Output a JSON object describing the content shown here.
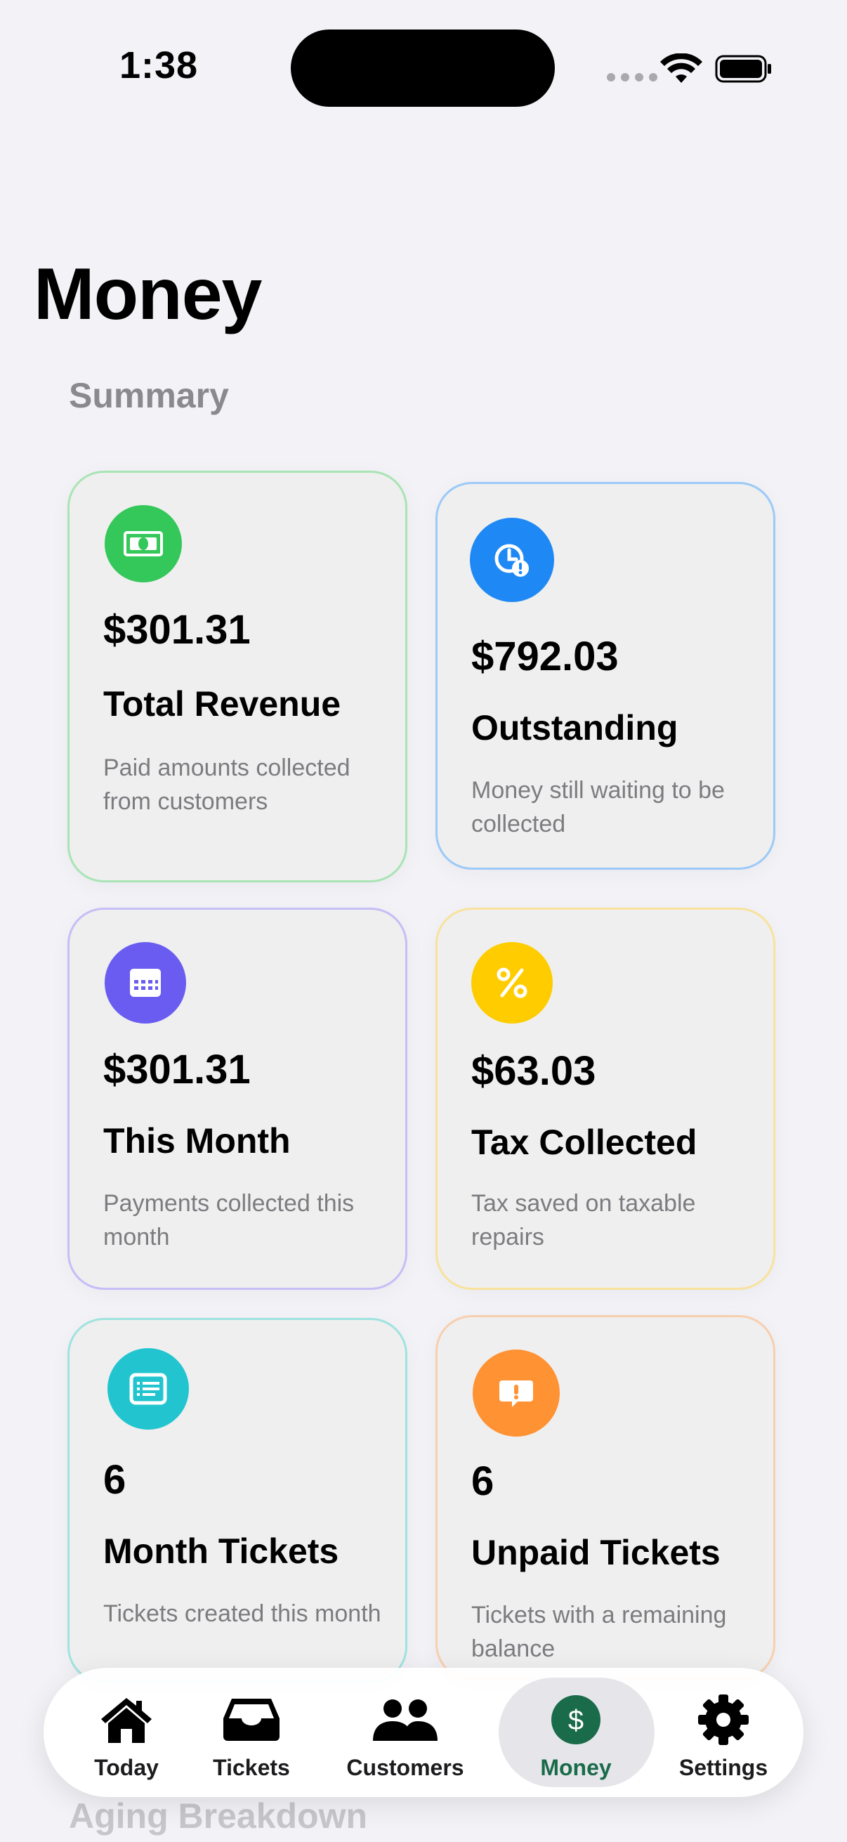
{
  "status_bar": {
    "time": "1:38"
  },
  "page": {
    "title": "Money"
  },
  "summary": {
    "label": "Summary",
    "cards": [
      {
        "value": "$301.31",
        "label": "Total Revenue",
        "desc": "Paid amounts collected from customers",
        "icon": "banknote-icon",
        "color": "#34c759"
      },
      {
        "value": "$792.03",
        "label": "Outstanding",
        "desc": "Money still waiting to be collected",
        "icon": "clock-alert-icon",
        "color": "#1e88f5"
      },
      {
        "value": "$301.31",
        "label": "This Month",
        "desc": "Payments collected this month",
        "icon": "calendar-icon",
        "color": "#6a5cf0"
      },
      {
        "value": "$63.03",
        "label": "Tax Collected",
        "desc": "Tax saved on taxable repairs",
        "icon": "percent-icon",
        "color": "#ffcc00"
      },
      {
        "value": "6",
        "label": "Month Tickets",
        "desc": "Tickets created this month",
        "icon": "list-card-icon",
        "color": "#22c5cf"
      },
      {
        "value": "6",
        "label": "Unpaid Tickets",
        "desc": "Tickets with a remaining balance",
        "icon": "exclamation-bubble-icon",
        "color": "#ff9233"
      }
    ]
  },
  "next_section": {
    "label": "Aging Breakdown"
  },
  "tabbar": {
    "items": [
      {
        "label": "Today",
        "icon": "house-icon"
      },
      {
        "label": "Tickets",
        "icon": "tray-icon"
      },
      {
        "label": "Customers",
        "icon": "people-icon"
      },
      {
        "label": "Money",
        "icon": "dollar-circle-icon",
        "active": true
      },
      {
        "label": "Settings",
        "icon": "gear-icon"
      }
    ],
    "active_color": "#1a6b4a"
  }
}
